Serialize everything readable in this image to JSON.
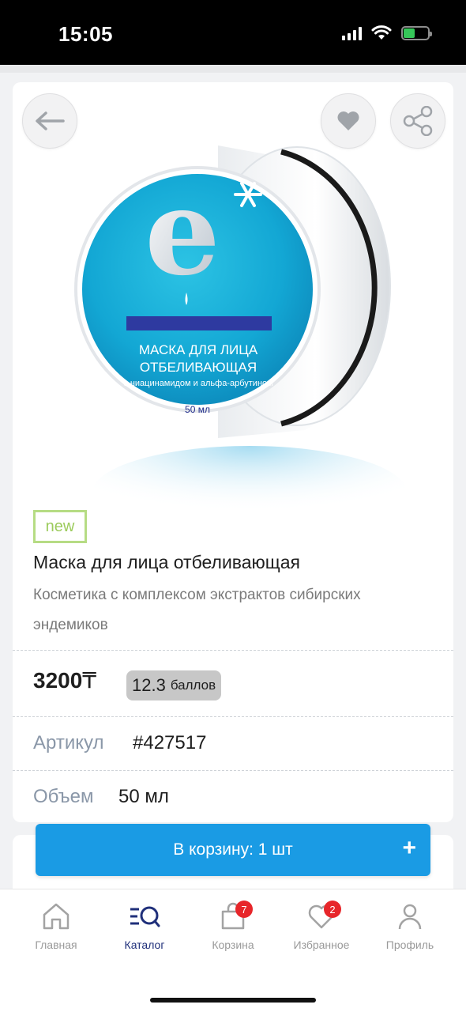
{
  "status_bar": {
    "time": "15:05",
    "battery_level": 0.45
  },
  "product": {
    "badge": "new",
    "title": "Маска для лица отбеливающая",
    "subtitle": "Косметика с комплексом экстрактов сибирских эндемиков",
    "price": "3200",
    "currency": "₸",
    "points_value": "12.3",
    "points_unit": "баллов",
    "article_label": "Артикул",
    "article_value": "#427517",
    "volume_label": "Объем",
    "volume_value": "50 мл",
    "image_text": {
      "line1": "МАСКА ДЛЯ ЛИЦА",
      "line2": "ОТБЕЛИВАЮЩАЯ",
      "line3": "с ниацинамидом и альфа-арбутином",
      "line4": "50 мл",
      "logo": "e"
    }
  },
  "actions": {
    "add_to_cart": "В корзину: 1 шт",
    "plus": "+"
  },
  "tabs": [
    {
      "label": "Главная",
      "icon": "home-icon"
    },
    {
      "label": "Каталог",
      "icon": "catalog-search-icon",
      "active": true
    },
    {
      "label": "Корзина",
      "icon": "bag-icon",
      "badge": "7"
    },
    {
      "label": "Избранное",
      "icon": "heart-icon",
      "badge": "2"
    },
    {
      "label": "Профиль",
      "icon": "profile-icon"
    }
  ],
  "colors": {
    "accent": "#1a9be4",
    "active_tab": "#1f2f7a",
    "badge_red": "#e7262a",
    "new_badge": "#b6dc84",
    "jar_turquoise": "#16a9d2"
  }
}
